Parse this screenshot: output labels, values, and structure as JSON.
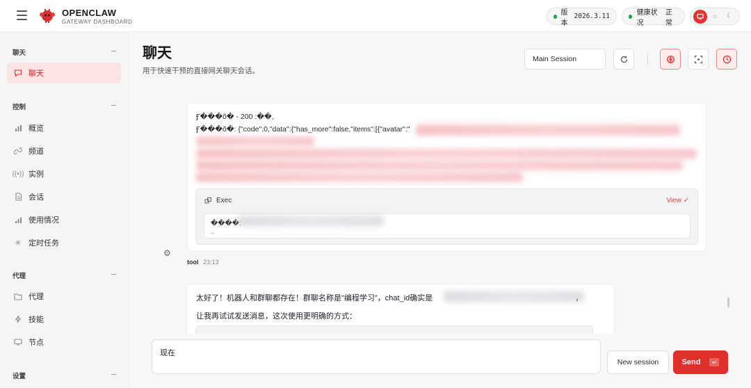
{
  "brand": {
    "title": "OPENCLAW",
    "subtitle": "GATEWAY DASHBOARD"
  },
  "status": {
    "version_label": "版本",
    "version_value": "2026.3.11",
    "health_label": "健康状况",
    "health_value": "正常",
    "status_color": "#22a34a"
  },
  "theme": {
    "options": [
      "monitor-icon",
      "sun-icon",
      "moon-icon"
    ],
    "active": "monitor-icon",
    "accent": "#e0302b"
  },
  "sidebar": {
    "sections": [
      {
        "label": "聊天",
        "items": [
          {
            "label": "聊天",
            "icon": "chat-bubble-icon",
            "active": true
          }
        ]
      },
      {
        "label": "控制",
        "items": [
          {
            "label": "概览",
            "icon": "bar-chart-icon"
          },
          {
            "label": "频道",
            "icon": "link-icon"
          },
          {
            "label": "实例",
            "icon": "broadcast-icon"
          },
          {
            "label": "会话",
            "icon": "document-icon"
          },
          {
            "label": "使用情况",
            "icon": "usage-chart-icon"
          },
          {
            "label": "定时任务",
            "icon": "loader-icon"
          }
        ]
      },
      {
        "label": "代理",
        "items": [
          {
            "label": "代理",
            "icon": "folder-icon"
          },
          {
            "label": "技能",
            "icon": "lightning-icon"
          },
          {
            "label": "节点",
            "icon": "monitor-icon"
          }
        ]
      },
      {
        "label": "设置",
        "items": []
      }
    ]
  },
  "page": {
    "title": "聊天",
    "subtitle": "用于快速干预的直接网关聊天会话。"
  },
  "toolbar": {
    "session": "Main Session"
  },
  "chat": {
    "tool_message": {
      "lines": [
        "Ӻ���õ� - 200 :��,",
        "Ӻ���õ�: {\"code\":0,\"data\":{\"has_more\":false,\"items\":[{\"avatar\":\""
      ],
      "exec_label": "Exec",
      "exec_view": "View ✓",
      "exec_output": "����:",
      "exec_output_more": "–",
      "author": "tool",
      "time": "23:13"
    },
    "assistant_message": {
      "line1": "太好了！机器人和群聊都存在！群聊名称是\"编程学习\"，chat_id确实是",
      "line1_end": "，",
      "line2": "让我再试试发送消息，这次使用更明确的方式："
    }
  },
  "composer": {
    "value": "现在",
    "new_session": "New session",
    "send": "Send",
    "send_kbd": "↵"
  }
}
